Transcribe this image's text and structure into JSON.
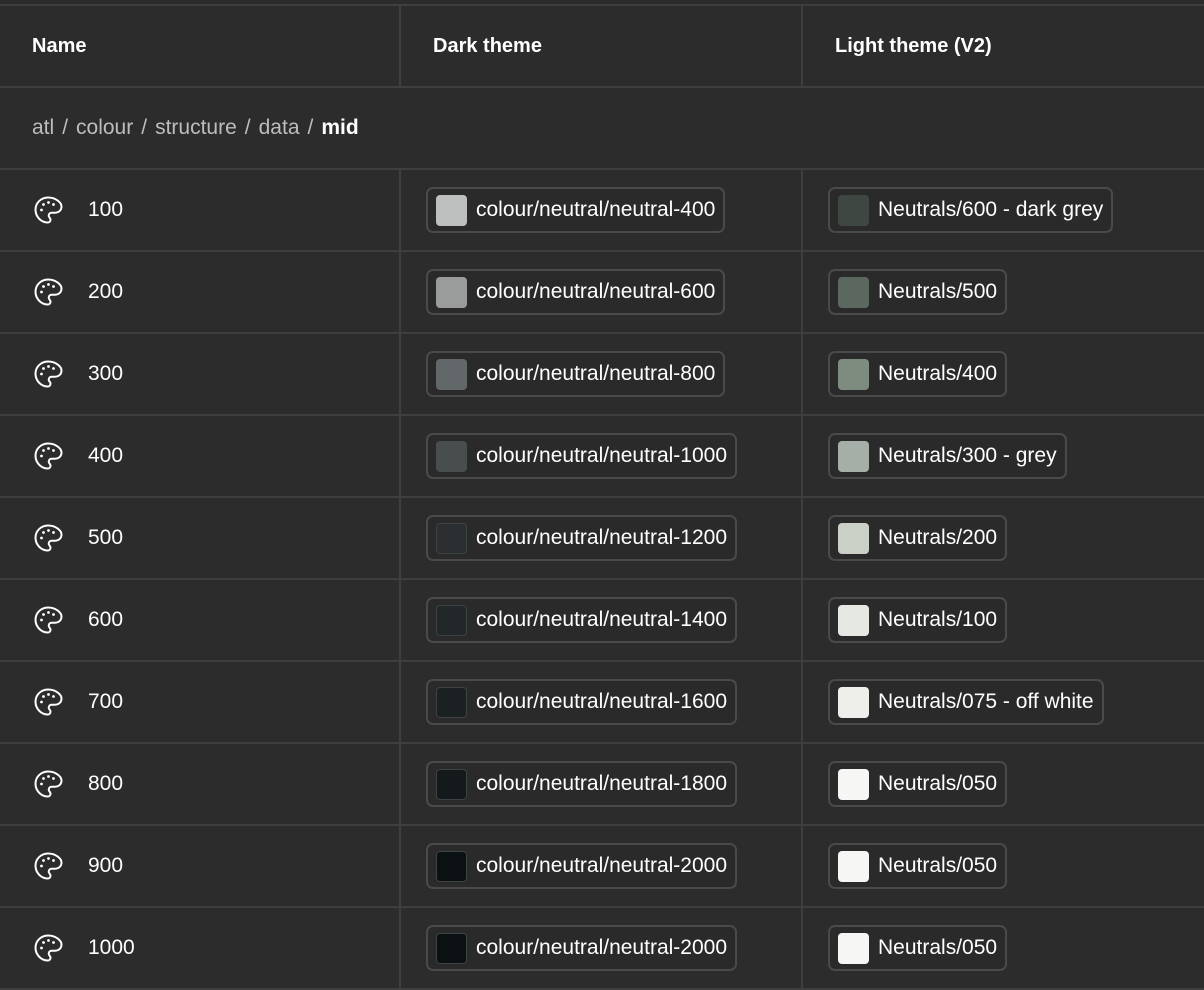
{
  "header": {
    "name": "Name",
    "dark": "Dark theme",
    "light": "Light theme (V2)"
  },
  "group": {
    "crumbs": [
      "atl",
      "colour",
      "structure",
      "data"
    ],
    "current": "mid"
  },
  "rows": [
    {
      "name": "100",
      "dark": {
        "label": "colour/neutral/neutral-400",
        "color": "#bdbfbf"
      },
      "light": {
        "label": "Neutrals/600 - dark grey",
        "color": "#3e4741"
      }
    },
    {
      "name": "200",
      "dark": {
        "label": "colour/neutral/neutral-600",
        "color": "#9a9b9b"
      },
      "light": {
        "label": "Neutrals/500",
        "color": "#5c685f"
      }
    },
    {
      "name": "300",
      "dark": {
        "label": "colour/neutral/neutral-800",
        "color": "#626869"
      },
      "light": {
        "label": "Neutrals/400",
        "color": "#7e8c80"
      }
    },
    {
      "name": "400",
      "dark": {
        "label": "colour/neutral/neutral-1000",
        "color": "#484d4d"
      },
      "light": {
        "label": "Neutrals/300 - grey",
        "color": "#a5afa7"
      }
    },
    {
      "name": "500",
      "dark": {
        "label": "colour/neutral/neutral-1200",
        "color": "#2b2f32"
      },
      "light": {
        "label": "Neutrals/200",
        "color": "#cbd0c7"
      }
    },
    {
      "name": "600",
      "dark": {
        "label": "colour/neutral/neutral-1400",
        "color": "#22272a"
      },
      "light": {
        "label": "Neutrals/100",
        "color": "#e6e9e3"
      }
    },
    {
      "name": "700",
      "dark": {
        "label": "colour/neutral/neutral-1600",
        "color": "#1b2023"
      },
      "light": {
        "label": "Neutrals/075 - off white",
        "color": "#eeeeea"
      }
    },
    {
      "name": "800",
      "dark": {
        "label": "colour/neutral/neutral-1800",
        "color": "#14191c"
      },
      "light": {
        "label": "Neutrals/050",
        "color": "#f6f6f4"
      }
    },
    {
      "name": "900",
      "dark": {
        "label": "colour/neutral/neutral-2000",
        "color": "#0b1013"
      },
      "light": {
        "label": "Neutrals/050",
        "color": "#f6f6f4"
      }
    },
    {
      "name": "1000",
      "dark": {
        "label": "colour/neutral/neutral-2000",
        "color": "#0b1013"
      },
      "light": {
        "label": "Neutrals/050",
        "color": "#f6f6f4"
      }
    }
  ]
}
